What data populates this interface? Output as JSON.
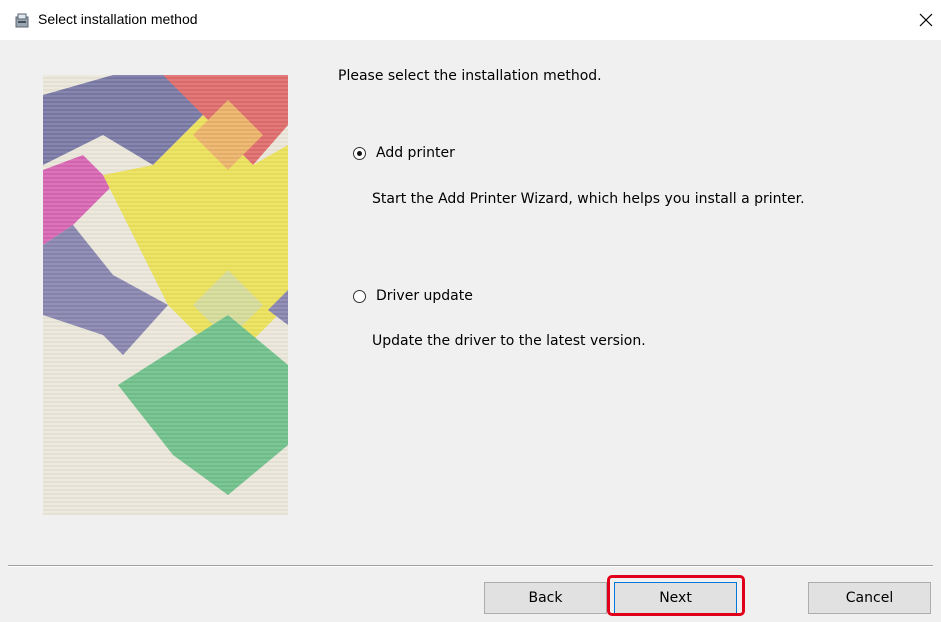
{
  "window": {
    "title": "Select installation method",
    "icon": "installer-icon",
    "close_glyph": "✕"
  },
  "content": {
    "instruction": "Please select the installation method.",
    "options": [
      {
        "label": "Add printer",
        "description": "Start the Add Printer Wizard, which helps you install a printer.",
        "selected": true
      },
      {
        "label": "Driver update",
        "description": "Update the driver to the latest version.",
        "selected": false
      }
    ]
  },
  "buttons": {
    "back": "Back",
    "next": "Next",
    "cancel": "Cancel"
  },
  "colors": {
    "highlight": "#e0001a",
    "dialog_bg": "#f0f0f0",
    "button_bg": "#e1e1e1",
    "focus_border": "#0078d7"
  }
}
